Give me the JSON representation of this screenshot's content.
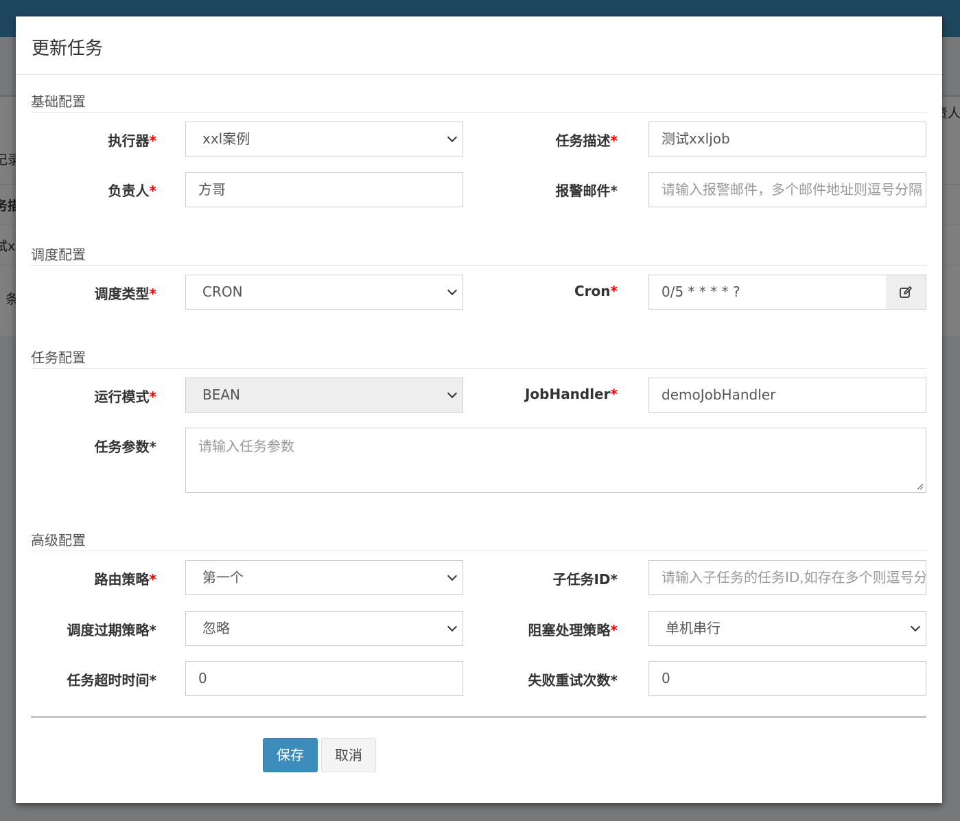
{
  "background": {
    "fragments": [
      "责人",
      "记录",
      "务描",
      "试xx",
      "条"
    ]
  },
  "modal": {
    "title": "更新任务",
    "sections": {
      "basic": "基础配置",
      "schedule": "调度配置",
      "task": "任务配置",
      "advanced": "高级配置"
    },
    "fields": {
      "executor": {
        "label": "执行器",
        "required_mark": "*",
        "value": "xxl案例"
      },
      "job_desc": {
        "label": "任务描述",
        "required_mark": "*",
        "value": "测试xxljob"
      },
      "author": {
        "label": "负责人",
        "required_mark": "*",
        "value": "方哥"
      },
      "alarm_email": {
        "label": "报警邮件*",
        "placeholder": "请输入报警邮件，多个邮件地址则逗号分隔"
      },
      "schedule_type": {
        "label": "调度类型",
        "required_mark": "*",
        "value": "CRON"
      },
      "cron": {
        "label": "Cron",
        "required_mark": "*",
        "value": "0/5 * * * * ?"
      },
      "glue_type": {
        "label": "运行模式",
        "required_mark": "*",
        "value": "BEAN"
      },
      "job_handler": {
        "label": "JobHandler",
        "required_mark": "*",
        "value": "demoJobHandler"
      },
      "job_param": {
        "label": "任务参数*",
        "placeholder": "请输入任务参数"
      },
      "route_strategy": {
        "label": "路由策略",
        "required_mark": "*",
        "value": "第一个"
      },
      "child_job_id": {
        "label": "子任务ID*",
        "placeholder": "请输入子任务的任务ID,如存在多个则逗号分隔"
      },
      "misfire_strategy": {
        "label": "调度过期策略*",
        "value": "忽略"
      },
      "block_strategy": {
        "label": "阻塞处理策略",
        "required_mark": "*",
        "value": "单机串行"
      },
      "timeout": {
        "label": "任务超时时间*",
        "value": "0"
      },
      "fail_retry": {
        "label": "失败重试次数*",
        "value": "0"
      }
    },
    "buttons": {
      "save": "保存",
      "cancel": "取消"
    }
  }
}
